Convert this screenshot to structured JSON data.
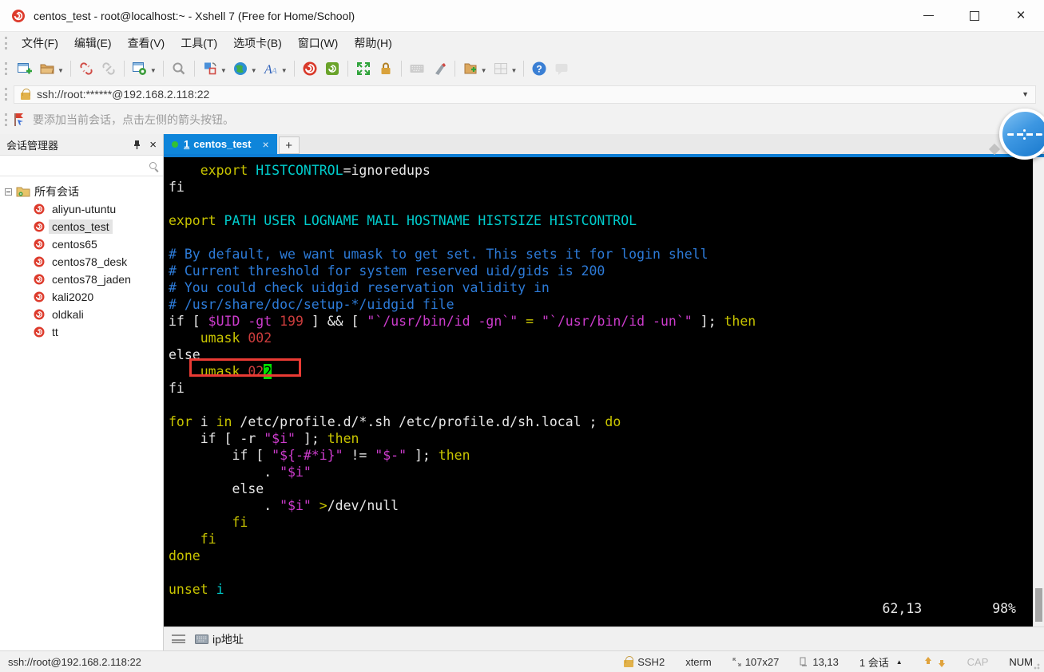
{
  "titlebar": {
    "title": "centos_test - root@localhost:~ - Xshell 7 (Free for Home/School)"
  },
  "menubar": {
    "items": [
      "文件(F)",
      "编辑(E)",
      "查看(V)",
      "工具(T)",
      "选项卡(B)",
      "窗口(W)",
      "帮助(H)"
    ]
  },
  "toolbar": {
    "icons": [
      "new-session",
      "open-session",
      "disconnect",
      "reconnect",
      "session-properties",
      "find",
      "screen-layout",
      "web-browser",
      "font",
      "xagent",
      "xftp",
      "fullscreen",
      "lock-screen",
      "virtual-keyboard",
      "compose-bar",
      "new-file",
      "tile-windows",
      "help",
      "feedback"
    ]
  },
  "addressbar": {
    "value": "ssh://root:******@192.168.2.118:22"
  },
  "infobar": {
    "message": "要添加当前会话，点击左侧的箭头按钮。"
  },
  "session_manager": {
    "title": "会话管理器",
    "root_label": "所有会话",
    "sessions": [
      {
        "name": "aliyun-utuntu",
        "selected": false
      },
      {
        "name": "centos_test",
        "selected": true
      },
      {
        "name": "centos65",
        "selected": false
      },
      {
        "name": "centos78_desk",
        "selected": false
      },
      {
        "name": "centos78_jaden",
        "selected": false
      },
      {
        "name": "kali2020",
        "selected": false
      },
      {
        "name": "oldkali",
        "selected": false
      },
      {
        "name": "tt",
        "selected": false
      }
    ]
  },
  "tabs": {
    "active_number": "1",
    "active_name": "centos_test",
    "close_glyph": "×",
    "new_tab_glyph": "+"
  },
  "terminal": {
    "ruler": {
      "position": "62,13",
      "scroll": "98%"
    },
    "lines": [
      [
        [
          "y",
          "    export"
        ],
        [
          "c",
          " HISTCONTROL"
        ],
        [
          "f",
          "=ignoredups"
        ]
      ],
      [
        [
          "f",
          "fi"
        ]
      ],
      [],
      [
        [
          "y",
          "export"
        ],
        [
          "c",
          " PATH USER LOGNAME MAIL HOSTNAME HISTSIZE HISTCONTROL"
        ]
      ],
      [],
      [
        [
          "b",
          "# By default, we want umask to get set. This sets it for login shell"
        ]
      ],
      [
        [
          "b",
          "# Current threshold for system reserved uid/gids is 200"
        ]
      ],
      [
        [
          "b",
          "# You could check uidgid reservation validity in"
        ]
      ],
      [
        [
          "b",
          "# /usr/share/doc/setup-*/uidgid file"
        ]
      ],
      [
        [
          "f",
          "if [ "
        ],
        [
          "m",
          "$UID"
        ],
        [
          "f",
          " "
        ],
        [
          "m",
          "-gt"
        ],
        [
          "f",
          " "
        ],
        [
          "r",
          "199"
        ],
        [
          "f",
          " ] && [ "
        ],
        [
          "m",
          "\"`/usr/bin/id -gn`\""
        ],
        [
          "f",
          " "
        ],
        [
          "y",
          "="
        ],
        [
          "f",
          " "
        ],
        [
          "m",
          "\"`/usr/bin/id -un`\""
        ],
        [
          "f",
          " ]; "
        ],
        [
          "y",
          "then"
        ]
      ],
      [
        [
          "y",
          "    umask"
        ],
        [
          "r",
          " 002"
        ]
      ],
      [
        [
          "f",
          "else"
        ]
      ],
      [
        [
          "y",
          "    umask"
        ],
        [
          "r",
          " 02"
        ],
        [
          "cur",
          "2"
        ]
      ],
      [
        [
          "f",
          "fi"
        ]
      ],
      [],
      [
        [
          "y",
          "for"
        ],
        [
          "f",
          " i "
        ],
        [
          "y",
          "in"
        ],
        [
          "f",
          " /etc/profile.d/*.sh /etc/profile.d/sh.local ; "
        ],
        [
          "y",
          "do"
        ]
      ],
      [
        [
          "f",
          "    if [ -r "
        ],
        [
          "m",
          "\"$i\""
        ],
        [
          "f",
          " ]; "
        ],
        [
          "y",
          "then"
        ]
      ],
      [
        [
          "f",
          "        if [ "
        ],
        [
          "m",
          "\"${-#*i}\""
        ],
        [
          "f",
          " != "
        ],
        [
          "m",
          "\"$-\""
        ],
        [
          "f",
          " ]; "
        ],
        [
          "y",
          "then"
        ]
      ],
      [
        [
          "f",
          "            . "
        ],
        [
          "m",
          "\"$i\""
        ]
      ],
      [
        [
          "f",
          "        else"
        ]
      ],
      [
        [
          "f",
          "            . "
        ],
        [
          "m",
          "\"$i\""
        ],
        [
          "f",
          " "
        ],
        [
          "y",
          ">"
        ],
        [
          "f",
          "/dev/null"
        ]
      ],
      [
        [
          "y",
          "        fi"
        ]
      ],
      [
        [
          "y",
          "    fi"
        ]
      ],
      [
        [
          "y",
          "done"
        ]
      ],
      [],
      [
        [
          "y",
          "unset"
        ],
        [
          "c",
          " i"
        ]
      ]
    ]
  },
  "quickbar": {
    "button_label": "ip地址"
  },
  "statusbar": {
    "left": "ssh://root@192.168.2.118:22",
    "protocol": "SSH2",
    "terminal_type": "xterm",
    "size": "107x27",
    "cursor_pos": "13,13",
    "session_count": "1 会话",
    "cap": "CAP",
    "num": "NUM"
  }
}
